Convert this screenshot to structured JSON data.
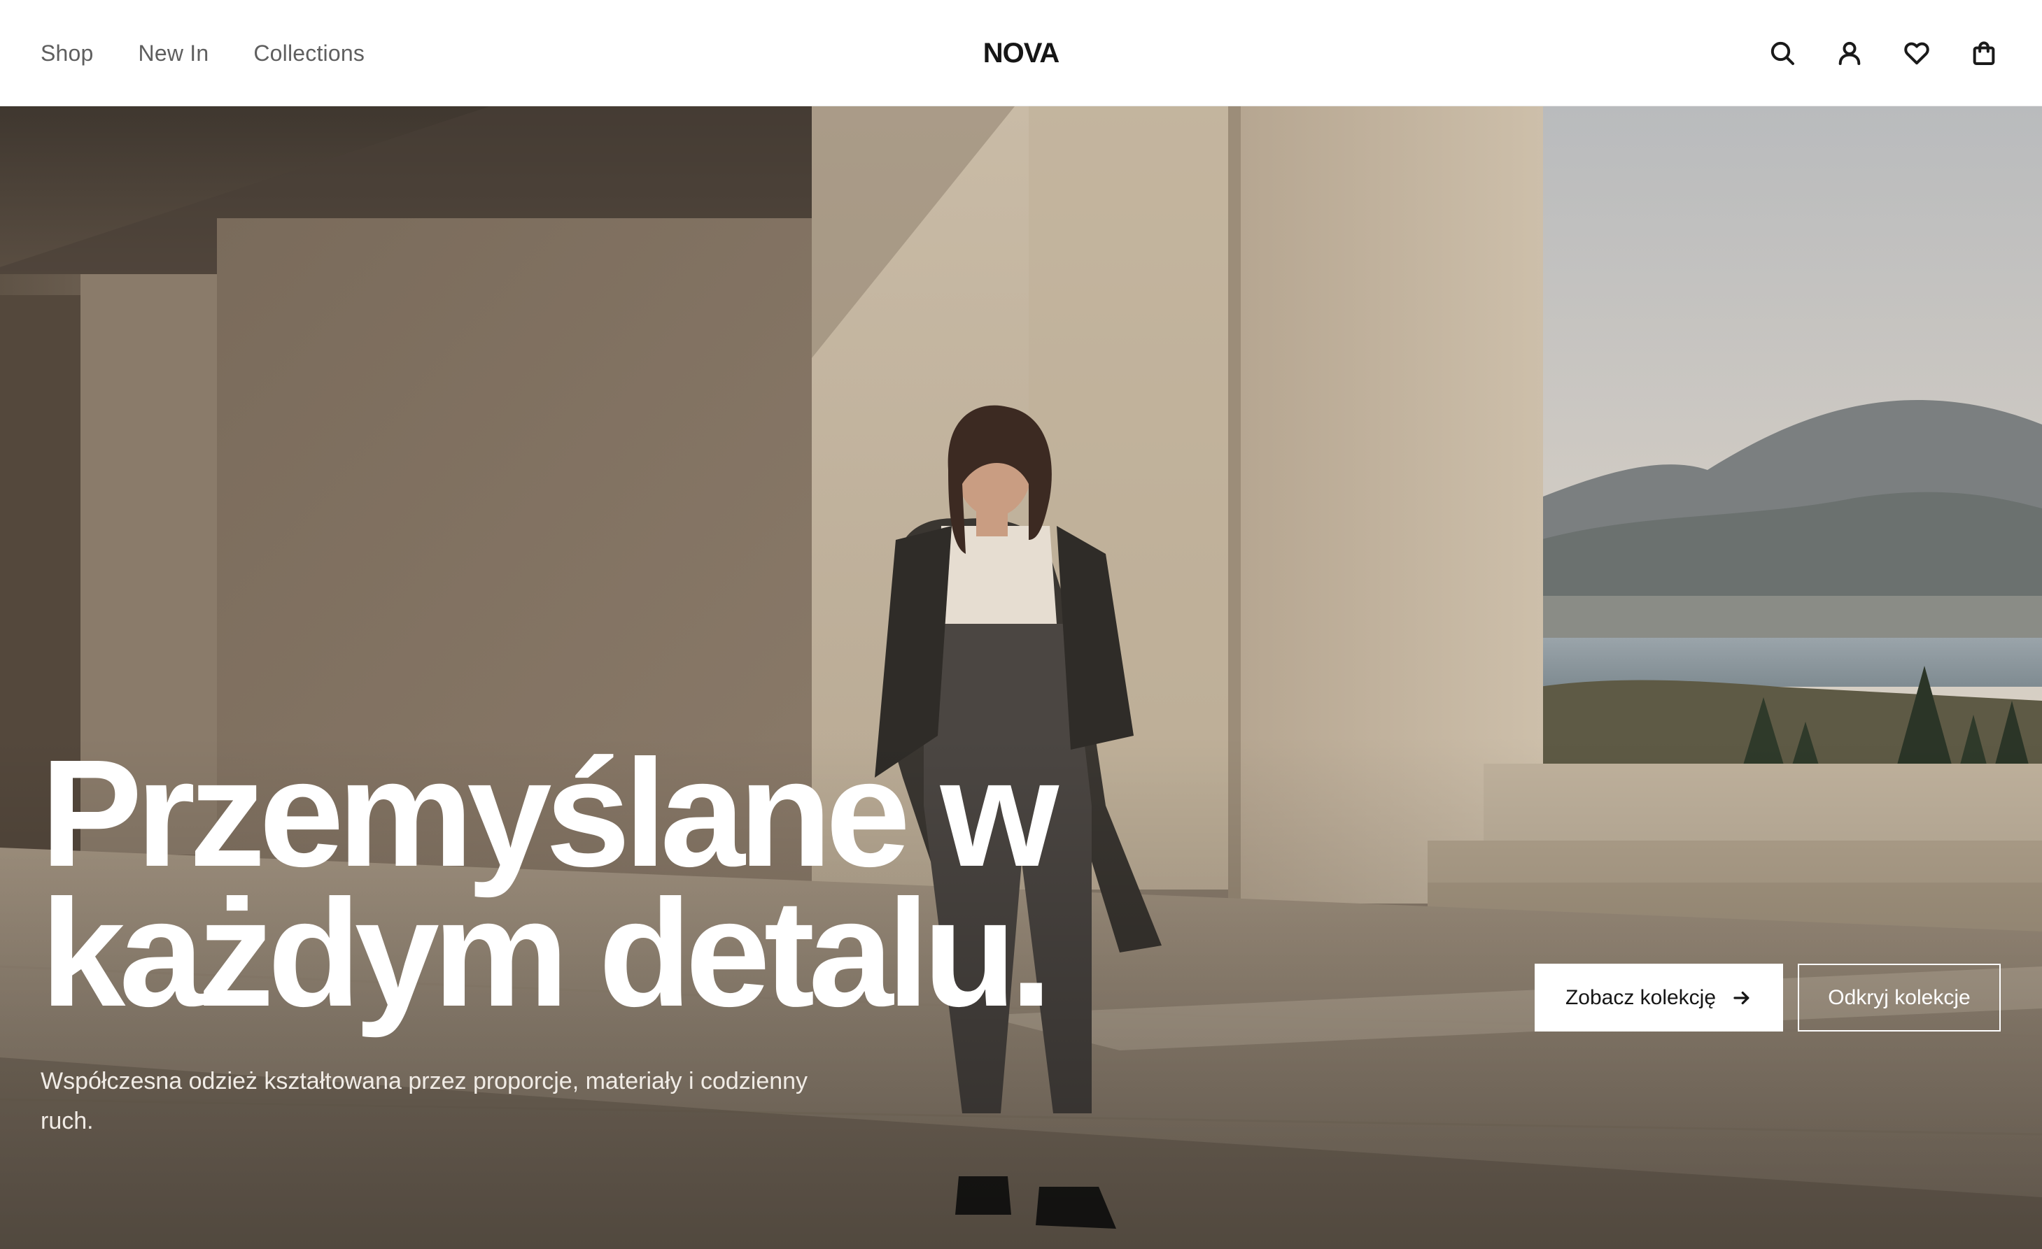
{
  "header": {
    "nav": [
      {
        "label": "Shop"
      },
      {
        "label": "New In"
      },
      {
        "label": "Collections"
      }
    ],
    "logo": "NOVA",
    "icons": [
      "search-icon",
      "user-icon",
      "heart-icon",
      "bag-icon"
    ]
  },
  "hero": {
    "headline_line1": "Przemyślane w",
    "headline_line2": "każdym detalu.",
    "subtext": "Współczesna odzież kształtowana przez proporcje, materiały i codzienny ruch.",
    "cta_primary": "Zobacz kolekcję",
    "cta_secondary": "Odkryj kolekcje"
  },
  "colors": {
    "text_dark": "#161616",
    "nav_text": "#5f5f5f",
    "hero_text": "#ffffff"
  }
}
